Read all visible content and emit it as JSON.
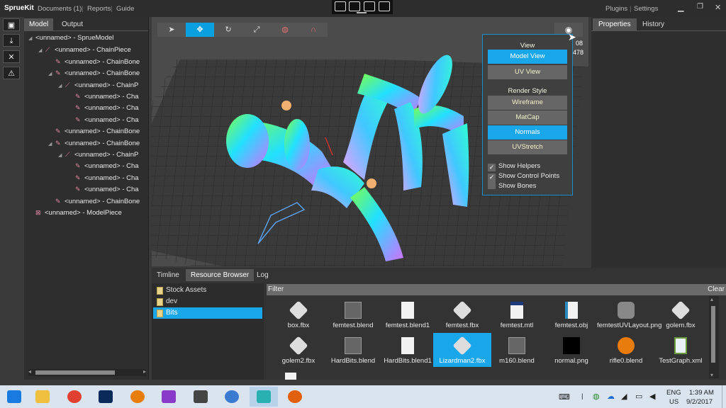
{
  "window": {
    "app_name": "SprueKit",
    "menu": [
      "Documents (1)",
      "Reports",
      "Guide"
    ],
    "right_menu": [
      "Plugins",
      "Settings"
    ]
  },
  "left_panel": {
    "tabs": [
      "Model",
      "Output"
    ],
    "tree": [
      {
        "label": "<unnamed> - SprueModel",
        "indent": 0,
        "arrow": "◢",
        "icon": ""
      },
      {
        "label": "<unnamed> - ChainPiece",
        "indent": 1,
        "arrow": "◢",
        "icon": "chain-icon"
      },
      {
        "label": "<unnamed> - ChainBone",
        "indent": 2,
        "arrow": "",
        "icon": "bone-icon"
      },
      {
        "label": "<unnamed> - ChainBone",
        "indent": 2,
        "arrow": "◢",
        "icon": "bone-icon"
      },
      {
        "label": "<unnamed> - ChainP",
        "indent": 3,
        "arrow": "◢",
        "icon": "chain-icon"
      },
      {
        "label": "<unnamed> - Cha",
        "indent": 4,
        "arrow": "",
        "icon": "bone-icon"
      },
      {
        "label": "<unnamed> - Cha",
        "indent": 4,
        "arrow": "",
        "icon": "bone-icon"
      },
      {
        "label": "<unnamed> - Cha",
        "indent": 4,
        "arrow": "",
        "icon": "bone-icon"
      },
      {
        "label": "<unnamed> - ChainBone",
        "indent": 2,
        "arrow": "",
        "icon": "bone-icon"
      },
      {
        "label": "<unnamed> - ChainBone",
        "indent": 2,
        "arrow": "◢",
        "icon": "bone-icon"
      },
      {
        "label": "<unnamed> - ChainP",
        "indent": 3,
        "arrow": "◢",
        "icon": "chain-icon"
      },
      {
        "label": "<unnamed> - Cha",
        "indent": 4,
        "arrow": "",
        "icon": "bone-icon"
      },
      {
        "label": "<unnamed> - Cha",
        "indent": 4,
        "arrow": "",
        "icon": "bone-icon"
      },
      {
        "label": "<unnamed> - Cha",
        "indent": 4,
        "arrow": "",
        "icon": "bone-icon"
      },
      {
        "label": "<unnamed> - ChainBone",
        "indent": 2,
        "arrow": "",
        "icon": "bone-icon"
      },
      {
        "label": "<unnamed> - ModelPiece",
        "indent": 0,
        "arrow": "",
        "icon": "model-piece-icon"
      }
    ]
  },
  "viewport": {
    "tools": [
      "select-icon",
      "move-icon",
      "rotate-icon",
      "scale-icon",
      "sphere-icon",
      "magnet-icon"
    ],
    "active_tool": 1,
    "stats": [
      "08",
      "478"
    ]
  },
  "view_menu": {
    "view_heading": "View",
    "view_buttons": [
      {
        "label": "Model View",
        "active": true
      },
      {
        "label": "UV View",
        "active": false
      }
    ],
    "render_heading": "Render Style",
    "render_buttons": [
      {
        "label": "Wireframe",
        "active": false
      },
      {
        "label": "MatCap",
        "active": false
      },
      {
        "label": "Normals",
        "active": true
      },
      {
        "label": "UVStretch",
        "active": false
      }
    ],
    "checks": [
      {
        "label": "Show Helpers",
        "checked": true
      },
      {
        "label": "Show Control Points",
        "checked": true
      },
      {
        "label": "Show Bones",
        "checked": false
      }
    ]
  },
  "right_panel": {
    "tabs": [
      "Properties",
      "History"
    ]
  },
  "bottom_panel": {
    "tabs": [
      "Timline",
      "Resource Browser",
      "Log"
    ],
    "active_tab": 1,
    "folders": [
      {
        "label": "Stock Assets",
        "selected": false
      },
      {
        "label": "dev",
        "selected": false
      },
      {
        "label": "Bits",
        "selected": true
      }
    ],
    "filter_label": "Filter",
    "clear_label": "Clear",
    "files": [
      {
        "name": "box.fbx",
        "icon": "model-file-icon"
      },
      {
        "name": "femtest.blend",
        "icon": "blend-file-icon"
      },
      {
        "name": "femtest.blend1",
        "icon": "document-icon"
      },
      {
        "name": "femtest.fbx",
        "icon": "model-file-icon"
      },
      {
        "name": "femtest.mtl",
        "icon": "mtl-file-icon"
      },
      {
        "name": "femtest.obj",
        "icon": "obj-file-icon"
      },
      {
        "name": "femtestUVLayout.png",
        "icon": "image-thumb-icon"
      },
      {
        "name": "golem.fbx",
        "icon": "model-file-icon"
      },
      {
        "name": "golem2.fbx",
        "icon": "model-file-icon"
      },
      {
        "name": "HardBits.blend",
        "icon": "blend-file-icon"
      },
      {
        "name": "HardBits.blend1",
        "icon": "document-icon"
      },
      {
        "name": "Lizardman2.fbx",
        "icon": "model-file-icon",
        "selected": true
      },
      {
        "name": "m160.blend",
        "icon": "blend-file-icon"
      },
      {
        "name": "normal.png",
        "icon": "black-image-icon"
      },
      {
        "name": "rifle0.blend",
        "icon": "blender-icon"
      },
      {
        "name": "TestGraph.xml",
        "icon": "xml-file-icon"
      }
    ]
  },
  "taskbar": {
    "apps": [
      "windows-start-icon",
      "file-explorer-icon",
      "chrome-icon",
      "photoshop-icon",
      "blender-icon",
      "visual-studio-icon",
      "terminal-icon",
      "thunderbird-icon",
      "spruekit-icon",
      "firefox-icon"
    ],
    "active_app": 8,
    "lang": [
      "ENG",
      "US"
    ],
    "time": "1:39 AM",
    "date": "9/2/2017"
  },
  "colors": {
    "accent": "#1aa7ea",
    "panel": "#2e2e2e",
    "taskbar": "#d9e4ef"
  }
}
